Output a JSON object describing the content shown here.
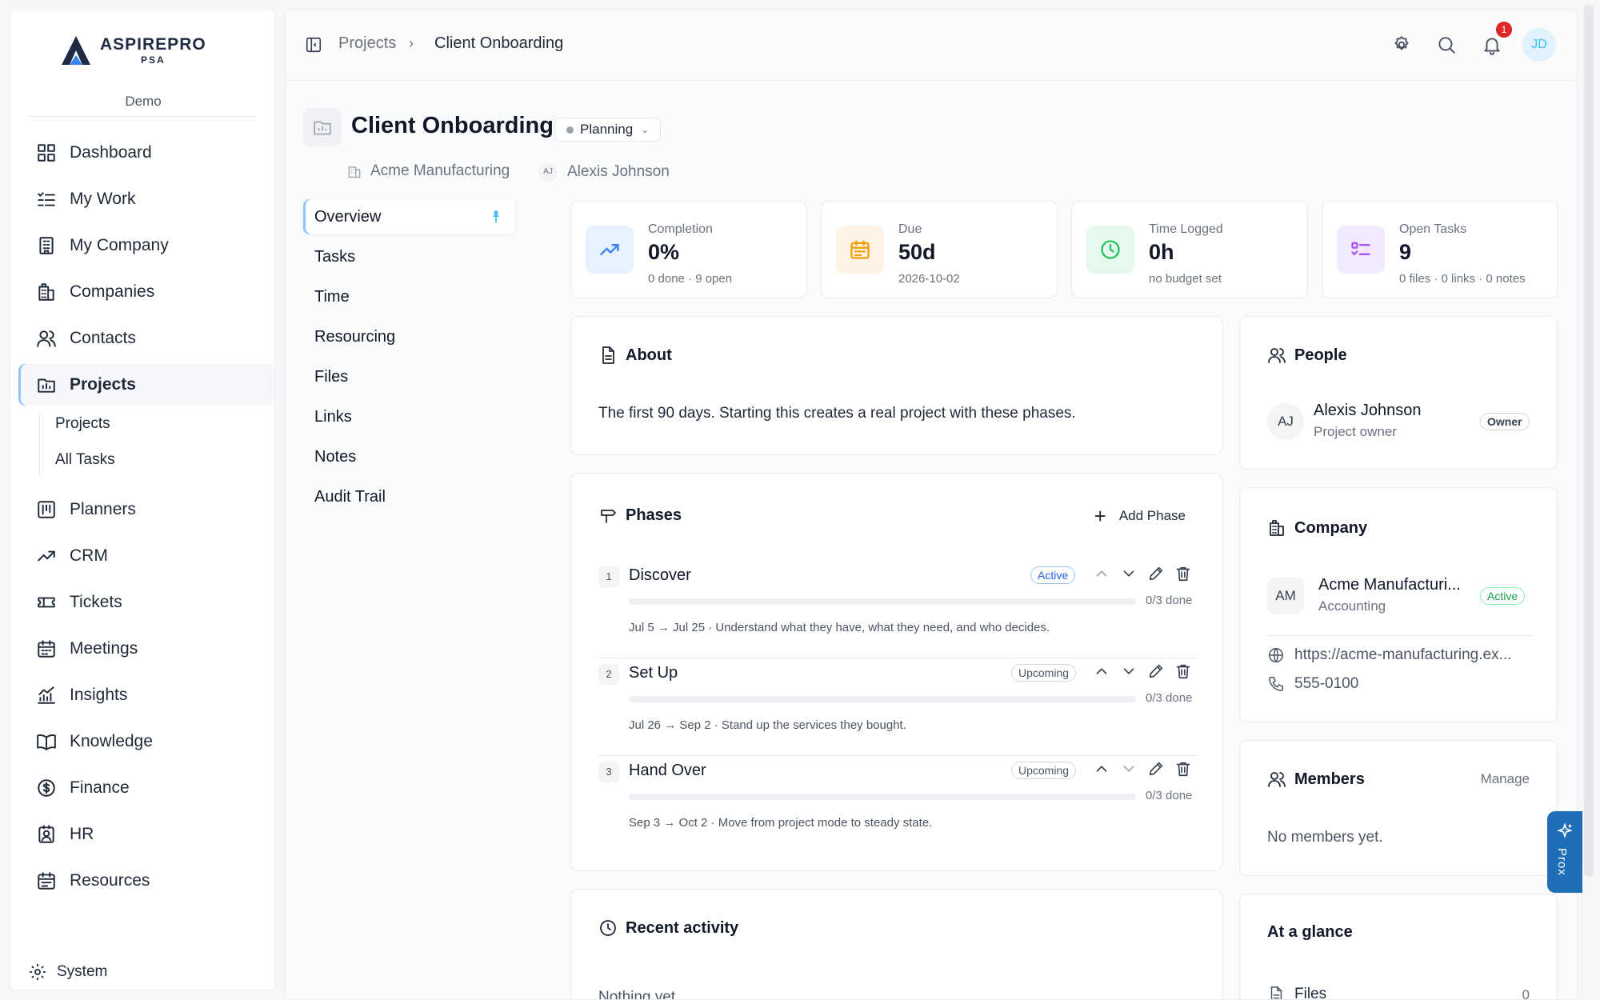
{
  "brand": {
    "name": "ASPIREPRO",
    "sub": "PSA",
    "tenant": "Demo"
  },
  "sidebar": {
    "items": [
      {
        "label": "Dashboard",
        "icon": "dashboard-icon"
      },
      {
        "label": "My Work",
        "icon": "list-check-icon"
      },
      {
        "label": "My Company",
        "icon": "building-icon"
      },
      {
        "label": "Companies",
        "icon": "companies-icon"
      },
      {
        "label": "Contacts",
        "icon": "contacts-icon"
      },
      {
        "label": "Projects",
        "icon": "folder-chart-icon"
      },
      {
        "label": "Planners",
        "icon": "planner-icon"
      },
      {
        "label": "CRM",
        "icon": "trend-icon"
      },
      {
        "label": "Tickets",
        "icon": "ticket-icon"
      },
      {
        "label": "Meetings",
        "icon": "calendar-icon"
      },
      {
        "label": "Insights",
        "icon": "insights-icon"
      },
      {
        "label": "Knowledge",
        "icon": "book-icon"
      },
      {
        "label": "Finance",
        "icon": "dollar-icon"
      },
      {
        "label": "HR",
        "icon": "hr-icon"
      },
      {
        "label": "Resources",
        "icon": "resources-icon"
      }
    ],
    "sub_items": [
      "Projects",
      "All Tasks"
    ],
    "system_label": "System"
  },
  "topbar": {
    "breadcrumb": [
      "Projects",
      "Client Onboarding"
    ],
    "notification_count": "1",
    "user_initials": "JD"
  },
  "project": {
    "title": "Client Onboarding",
    "status": "Planning",
    "company": "Acme Manufacturing",
    "owner_initials": "AJ",
    "owner": "Alexis Johnson"
  },
  "subnav": [
    "Overview",
    "Tasks",
    "Time",
    "Resourcing",
    "Files",
    "Links",
    "Notes",
    "Audit Trail"
  ],
  "stats": [
    {
      "label": "Completion",
      "value": "0%",
      "sub": "0 done · 9 open",
      "color": "#3b82f6",
      "bg": "#e8f1fe",
      "icon": "trend-up-icon"
    },
    {
      "label": "Due",
      "value": "50d",
      "sub": "2026-10-02",
      "color": "#f59e0b",
      "bg": "#fef3e4",
      "icon": "calendar-icon"
    },
    {
      "label": "Time Logged",
      "value": "0h",
      "sub": "no budget set",
      "color": "#22c55e",
      "bg": "#e7f8ee",
      "icon": "clock-icon"
    },
    {
      "label": "Open Tasks",
      "value": "9",
      "sub": "0 files · 0 links · 0 notes",
      "color": "#a855f7",
      "bg": "#f3e9fe",
      "icon": "task-list-icon"
    }
  ],
  "about": {
    "title": "About",
    "text": "The first 90 days. Starting this creates a real project with these phases."
  },
  "phases": {
    "title": "Phases",
    "add_label": "Add Phase",
    "items": [
      {
        "num": "1",
        "name": "Discover",
        "status": "Active",
        "done": "0/3 done",
        "progress": 0,
        "desc": "Jul 5 → Jul 25 · Understand what they have, what they need, and who decides."
      },
      {
        "num": "2",
        "name": "Set Up",
        "status": "Upcoming",
        "done": "0/3 done",
        "progress": 0,
        "desc": "Jul 26 → Sep 2 · Stand up the services they bought."
      },
      {
        "num": "3",
        "name": "Hand Over",
        "status": "Upcoming",
        "done": "0/3 done",
        "progress": 0,
        "desc": "Sep 3 → Oct 2 · Move from project mode to steady state."
      }
    ]
  },
  "recent": {
    "title": "Recent activity",
    "empty": "Nothing yet."
  },
  "people": {
    "title": "People",
    "initials": "AJ",
    "name": "Alexis Johnson",
    "role": "Project owner",
    "tag": "Owner"
  },
  "company": {
    "title": "Company",
    "initials": "AM",
    "name": "Acme Manufacturi...",
    "industry": "Accounting",
    "status": "Active",
    "website": "https://acme-manufacturing.ex...",
    "phone": "555-0100"
  },
  "members": {
    "title": "Members",
    "manage": "Manage",
    "empty": "No members yet."
  },
  "glance": {
    "title": "At a glance",
    "files_label": "Files",
    "files_count": "0"
  },
  "assistant": {
    "label": "Prox"
  }
}
